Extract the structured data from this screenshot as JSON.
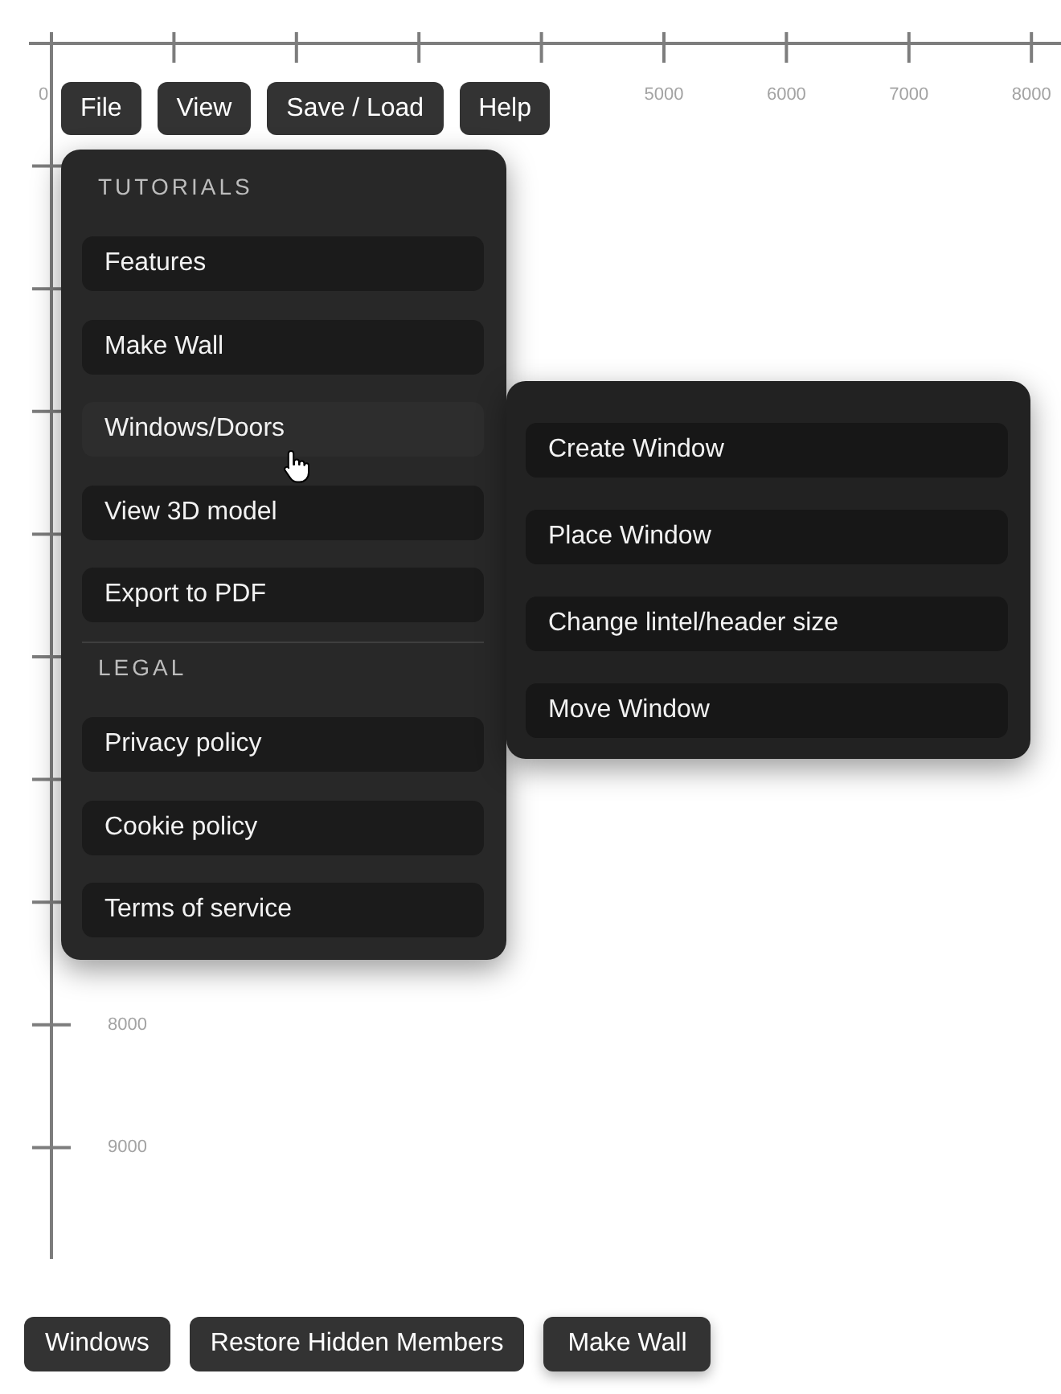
{
  "canvas": {
    "top_ruler": {
      "labels": [
        "0",
        "5000",
        "6000",
        "7000",
        "8000"
      ]
    },
    "left_ruler": {
      "labels": [
        "8000",
        "9000"
      ]
    }
  },
  "menubar": {
    "buttons": [
      "File",
      "View",
      "Save / Load",
      "Help"
    ]
  },
  "menu": {
    "sections": [
      {
        "heading": "TUTORIALS",
        "items": [
          {
            "label": "Features",
            "selected": false
          },
          {
            "label": "Make Wall",
            "selected": false
          },
          {
            "label": "Windows/Doors",
            "selected": true,
            "submenu": [
              {
                "label": "Create Window",
                "selected": false
              },
              {
                "label": "Place Window",
                "selected": false
              },
              {
                "label": "Change lintel/header size",
                "selected": false
              },
              {
                "label": "Move Window",
                "selected": false
              }
            ]
          },
          {
            "label": "View 3D model",
            "selected": false
          },
          {
            "label": "Export to PDF",
            "selected": false
          }
        ]
      },
      {
        "heading": "LEGAL",
        "items": [
          {
            "label": "Privacy policy",
            "selected": false
          },
          {
            "label": "Cookie policy",
            "selected": false
          },
          {
            "label": "Terms of service",
            "selected": false
          }
        ]
      }
    ]
  },
  "toolbar": {
    "buttons": [
      {
        "label": "Windows",
        "active": false
      },
      {
        "label": "Restore Hidden Members",
        "active": false
      },
      {
        "label": "Make Wall",
        "active": true
      }
    ]
  }
}
